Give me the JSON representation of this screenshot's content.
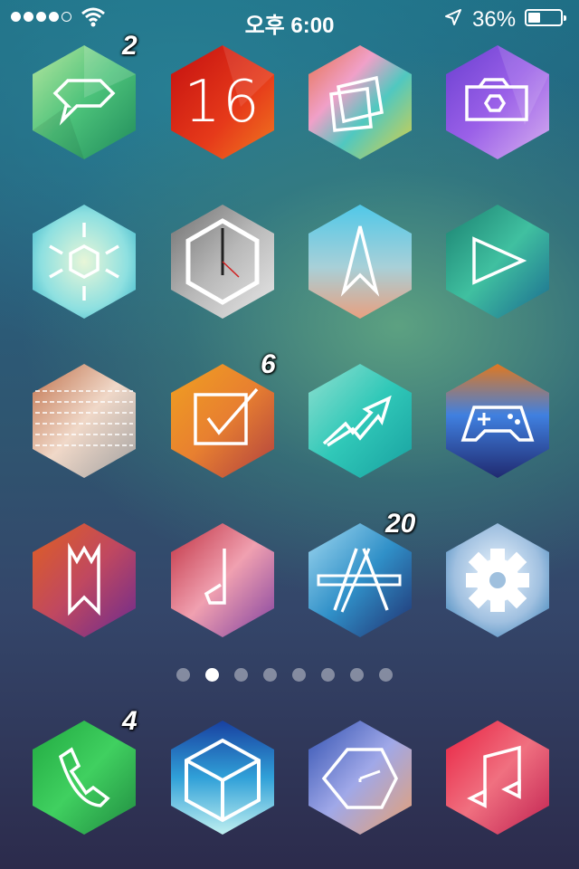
{
  "status_bar": {
    "time": "오후 6:00",
    "battery_percent": "36%",
    "battery_level": 0.36,
    "signal_bars_filled": 4,
    "signal_bars_total": 5
  },
  "badges": {
    "messages": "2",
    "reminders": "6",
    "app_store": "20",
    "phone": "4"
  },
  "calendar": {
    "day": "16"
  },
  "page_indicator": {
    "total": 8,
    "active_index": 1
  },
  "icons": {
    "row1": [
      "message-bubble-icon",
      "calendar-icon",
      "photos-icon",
      "camera-icon"
    ],
    "row2": [
      "weather-sun-icon",
      "clock-icon",
      "maps-arrow-icon",
      "videos-play-icon"
    ],
    "row3": [
      "notes-icon",
      "reminders-check-icon",
      "stocks-icon",
      "game-controller-icon"
    ],
    "row4": [
      "bookmark-icon",
      "music-note-icon",
      "app-store-icon",
      "settings-gear-icon"
    ],
    "dock": [
      "phone-icon",
      "cube-icon",
      "safari-icon",
      "music-icon"
    ]
  }
}
